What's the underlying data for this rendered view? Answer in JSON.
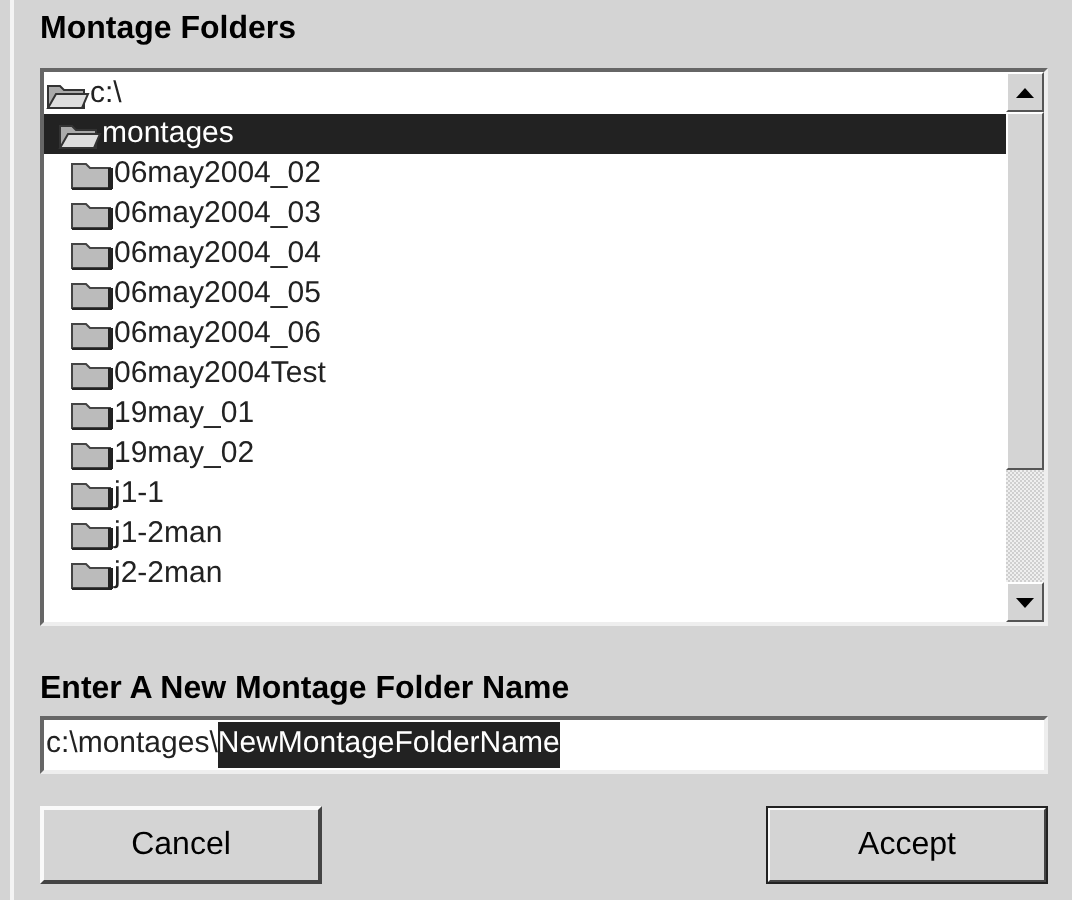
{
  "title": "Montage Folders",
  "tree": [
    {
      "label": "c:\\",
      "expanded": true,
      "selected": false,
      "children": [
        {
          "label": "montages",
          "expanded": true,
          "selected": true,
          "children": [
            {
              "label": "06may2004_02",
              "expanded": false,
              "selected": false
            },
            {
              "label": "06may2004_03",
              "expanded": false,
              "selected": false
            },
            {
              "label": "06may2004_04",
              "expanded": false,
              "selected": false
            },
            {
              "label": "06may2004_05",
              "expanded": false,
              "selected": false
            },
            {
              "label": "06may2004_06",
              "expanded": false,
              "selected": false
            },
            {
              "label": "06may2004Test",
              "expanded": false,
              "selected": false
            },
            {
              "label": "19may_01",
              "expanded": false,
              "selected": false
            },
            {
              "label": "19may_02",
              "expanded": false,
              "selected": false
            },
            {
              "label": "j1-1",
              "expanded": false,
              "selected": false
            },
            {
              "label": "j1-2man",
              "expanded": false,
              "selected": false
            },
            {
              "label": "j2-2man",
              "expanded": false,
              "selected": false
            }
          ]
        }
      ]
    }
  ],
  "name_label": "Enter A New Montage Folder Name",
  "name_field": {
    "value": "c:\\montages\\",
    "selection": "NewMontageFolderName"
  },
  "buttons": [
    {
      "label": "Cancel",
      "default": false
    },
    {
      "label": "Accept",
      "default": true
    }
  ]
}
